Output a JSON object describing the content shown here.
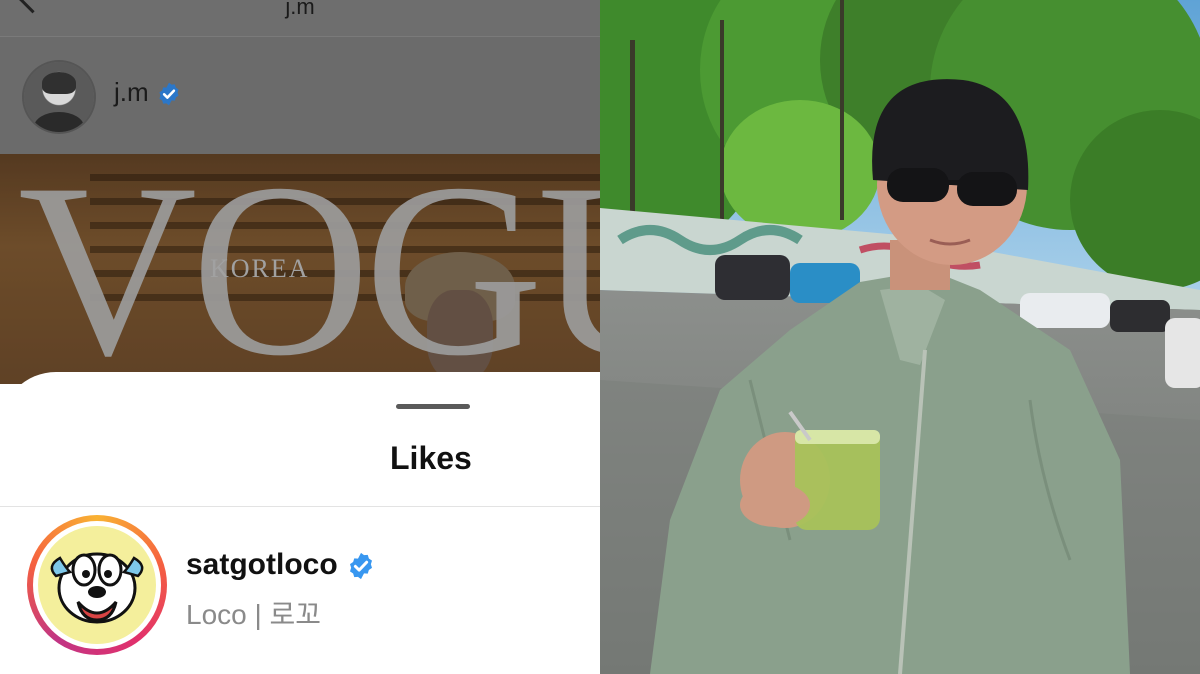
{
  "topbar": {
    "title": "j.m"
  },
  "post": {
    "author": "j.m",
    "image": {
      "masthead": "VOGUE",
      "edition": "KOREA"
    }
  },
  "likes_sheet": {
    "title": "Likes",
    "users": [
      {
        "username": "satgotloco",
        "display": "Loco | 로꼬",
        "verified": true
      }
    ]
  },
  "colors": {
    "verified_badge": "#3897f0",
    "story_ring": [
      "#f9b233",
      "#f56040",
      "#e1306c",
      "#c13584"
    ]
  }
}
